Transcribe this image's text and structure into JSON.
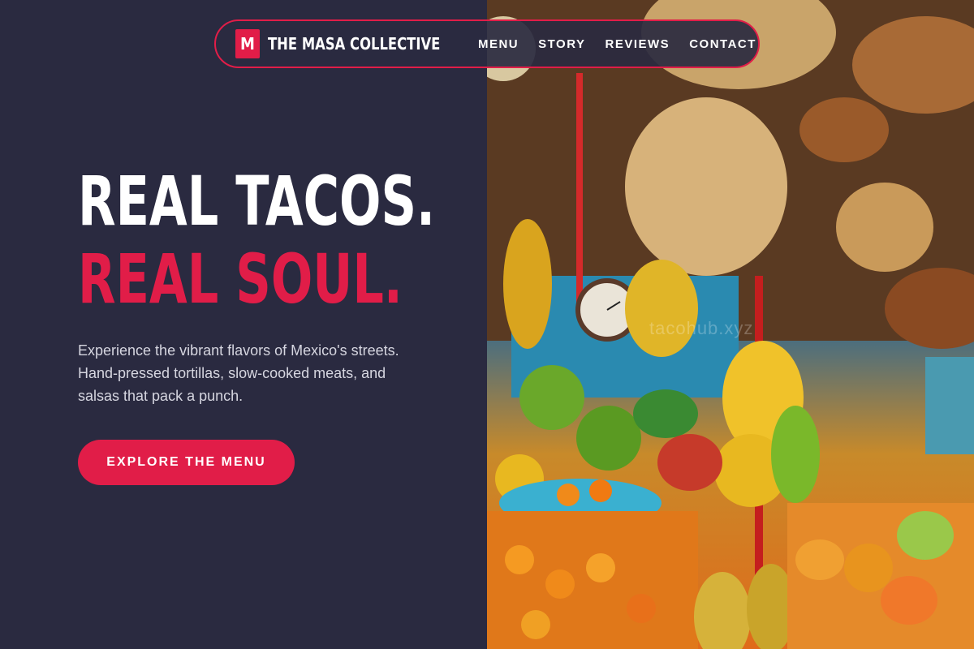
{
  "brand": {
    "mark": "M",
    "name": "THE MASA COLLECTIVE"
  },
  "nav": {
    "items": [
      {
        "label": "MENU"
      },
      {
        "label": "STORY"
      },
      {
        "label": "REVIEWS"
      },
      {
        "label": "CONTACT"
      }
    ]
  },
  "hero": {
    "title_line1": "REAL TACOS.",
    "title_line2": "REAL SOUL.",
    "description": "Experience the vibrant flavors of Mexico's streets. Hand-pressed tortillas, slow-cooked meats, and salsas that pack a punch.",
    "cta_label": "EXPLORE THE MENU"
  },
  "image": {
    "watermark": "tacohub.xyz"
  },
  "colors": {
    "background": "#2a2a40",
    "accent": "#e11d48",
    "text": "#ffffff"
  }
}
